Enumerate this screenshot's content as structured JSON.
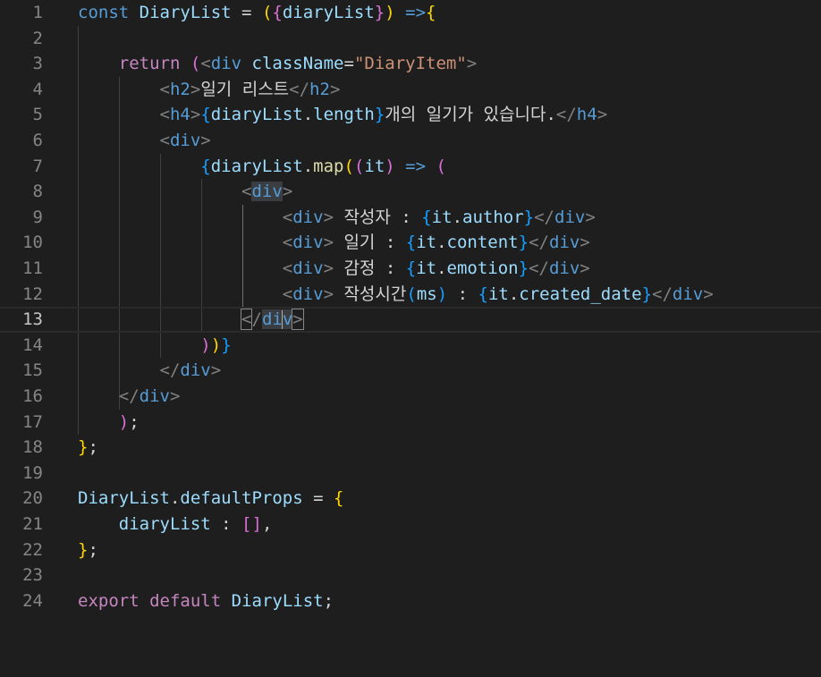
{
  "editor": {
    "theme": {
      "background": "#1e1e1e",
      "line_number": "#858585",
      "keyword": "#569cd6",
      "control": "#c586c0",
      "variable": "#9cdcfe",
      "function": "#dcdcaa",
      "string": "#ce9178",
      "bracket_gold": "#ffd700",
      "bracket_orchid": "#da70d6",
      "bracket_blue": "#179fff"
    },
    "current_line": 13,
    "lines": [
      {
        "n": "1",
        "tokens": [
          [
            "kw",
            "const"
          ],
          [
            "txt",
            " "
          ],
          [
            "var",
            "DiaryList"
          ],
          [
            "txt",
            " = "
          ],
          [
            "p1",
            "("
          ],
          [
            "p2",
            "{"
          ],
          [
            "var",
            "diaryList"
          ],
          [
            "p2",
            "}"
          ],
          [
            "p1",
            ")"
          ],
          [
            "txt",
            " "
          ],
          [
            "kw",
            "=>"
          ],
          [
            "p1",
            "{"
          ]
        ]
      },
      {
        "n": "2",
        "tokens": []
      },
      {
        "n": "3",
        "tokens": [
          [
            "txt",
            "    "
          ],
          [
            "ctl",
            "return"
          ],
          [
            "txt",
            " "
          ],
          [
            "p2",
            "("
          ],
          [
            "br",
            "<"
          ],
          [
            "tag",
            "div"
          ],
          [
            "txt",
            " "
          ],
          [
            "attr",
            "className"
          ],
          [
            "txt",
            "="
          ],
          [
            "str",
            "\"DiaryItem\""
          ],
          [
            "br",
            ">"
          ]
        ]
      },
      {
        "n": "4",
        "tokens": [
          [
            "txt",
            "        "
          ],
          [
            "br",
            "<"
          ],
          [
            "tag",
            "h2"
          ],
          [
            "br",
            ">"
          ],
          [
            "txt",
            "일기 리스트"
          ],
          [
            "br",
            "</"
          ],
          [
            "tag",
            "h2"
          ],
          [
            "br",
            ">"
          ]
        ]
      },
      {
        "n": "5",
        "tokens": [
          [
            "txt",
            "        "
          ],
          [
            "br",
            "<"
          ],
          [
            "tag",
            "h4"
          ],
          [
            "br",
            ">"
          ],
          [
            "p3",
            "{"
          ],
          [
            "var",
            "diaryList"
          ],
          [
            "txt",
            "."
          ],
          [
            "var",
            "length"
          ],
          [
            "p3",
            "}"
          ],
          [
            "txt",
            "개의 일기가 있습니다."
          ],
          [
            "br",
            "</"
          ],
          [
            "tag",
            "h4"
          ],
          [
            "br",
            ">"
          ]
        ]
      },
      {
        "n": "6",
        "tokens": [
          [
            "txt",
            "        "
          ],
          [
            "br",
            "<"
          ],
          [
            "tag",
            "div"
          ],
          [
            "br",
            ">"
          ]
        ]
      },
      {
        "n": "7",
        "tokens": [
          [
            "txt",
            "            "
          ],
          [
            "p3",
            "{"
          ],
          [
            "var",
            "diaryList"
          ],
          [
            "txt",
            "."
          ],
          [
            "fn",
            "map"
          ],
          [
            "p1",
            "("
          ],
          [
            "p2",
            "("
          ],
          [
            "var",
            "it"
          ],
          [
            "p2",
            ")"
          ],
          [
            "txt",
            " "
          ],
          [
            "kw",
            "=>"
          ],
          [
            "txt",
            " "
          ],
          [
            "p2",
            "("
          ]
        ]
      },
      {
        "n": "8",
        "tokens": [
          [
            "txt",
            "                "
          ],
          [
            "br",
            "<"
          ],
          [
            "tagsel",
            "div"
          ],
          [
            "br",
            ">"
          ]
        ]
      },
      {
        "n": "9",
        "tokens": [
          [
            "txt",
            "                    "
          ],
          [
            "br",
            "<"
          ],
          [
            "tag",
            "div"
          ],
          [
            "br",
            ">"
          ],
          [
            "txt",
            " 작성자 : "
          ],
          [
            "p3",
            "{"
          ],
          [
            "var",
            "it"
          ],
          [
            "txt",
            "."
          ],
          [
            "var",
            "author"
          ],
          [
            "p3",
            "}"
          ],
          [
            "br",
            "</"
          ],
          [
            "tag",
            "div"
          ],
          [
            "br",
            ">"
          ]
        ]
      },
      {
        "n": "10",
        "tokens": [
          [
            "txt",
            "                    "
          ],
          [
            "br",
            "<"
          ],
          [
            "tag",
            "div"
          ],
          [
            "br",
            ">"
          ],
          [
            "txt",
            " 일기 : "
          ],
          [
            "p3",
            "{"
          ],
          [
            "var",
            "it"
          ],
          [
            "txt",
            "."
          ],
          [
            "var",
            "content"
          ],
          [
            "p3",
            "}"
          ],
          [
            "br",
            "</"
          ],
          [
            "tag",
            "div"
          ],
          [
            "br",
            ">"
          ]
        ]
      },
      {
        "n": "11",
        "tokens": [
          [
            "txt",
            "                    "
          ],
          [
            "br",
            "<"
          ],
          [
            "tag",
            "div"
          ],
          [
            "br",
            ">"
          ],
          [
            "txt",
            " 감정 : "
          ],
          [
            "p3",
            "{"
          ],
          [
            "var",
            "it"
          ],
          [
            "txt",
            "."
          ],
          [
            "var",
            "emotion"
          ],
          [
            "p3",
            "}"
          ],
          [
            "br",
            "</"
          ],
          [
            "tag",
            "div"
          ],
          [
            "br",
            ">"
          ]
        ]
      },
      {
        "n": "12",
        "tokens": [
          [
            "txt",
            "                    "
          ],
          [
            "br",
            "<"
          ],
          [
            "tag",
            "div"
          ],
          [
            "br",
            ">"
          ],
          [
            "txt",
            " 작성시간"
          ],
          [
            "p3",
            "("
          ],
          [
            "var",
            "ms"
          ],
          [
            "p3",
            ")"
          ],
          [
            "txt",
            " : "
          ],
          [
            "p3",
            "{"
          ],
          [
            "var",
            "it"
          ],
          [
            "txt",
            "."
          ],
          [
            "var",
            "created_date"
          ],
          [
            "p3",
            "}"
          ],
          [
            "br",
            "</"
          ],
          [
            "tag",
            "div"
          ],
          [
            "br",
            ">"
          ]
        ]
      },
      {
        "n": "13",
        "tokens": [
          [
            "txt",
            "                "
          ],
          [
            "brm",
            "<"
          ],
          [
            "br",
            "/"
          ],
          [
            "tagsel",
            "di"
          ],
          [
            "caret",
            ""
          ],
          [
            "tagsel",
            "v"
          ],
          [
            "brm",
            ">"
          ]
        ]
      },
      {
        "n": "14",
        "tokens": [
          [
            "txt",
            "            "
          ],
          [
            "p2",
            ")"
          ],
          [
            "p1",
            ")"
          ],
          [
            "p3",
            "}"
          ]
        ]
      },
      {
        "n": "15",
        "tokens": [
          [
            "txt",
            "        "
          ],
          [
            "br",
            "</"
          ],
          [
            "tag",
            "div"
          ],
          [
            "br",
            ">"
          ]
        ]
      },
      {
        "n": "16",
        "tokens": [
          [
            "txt",
            "    "
          ],
          [
            "br",
            "</"
          ],
          [
            "tag",
            "div"
          ],
          [
            "br",
            ">"
          ]
        ]
      },
      {
        "n": "17",
        "tokens": [
          [
            "txt",
            "    "
          ],
          [
            "p2",
            ")"
          ],
          [
            "txt",
            ";"
          ]
        ]
      },
      {
        "n": "18",
        "tokens": [
          [
            "p1",
            "}"
          ],
          [
            "txt",
            ";"
          ]
        ]
      },
      {
        "n": "19",
        "tokens": []
      },
      {
        "n": "20",
        "tokens": [
          [
            "var",
            "DiaryList"
          ],
          [
            "txt",
            "."
          ],
          [
            "var",
            "defaultProps"
          ],
          [
            "txt",
            " = "
          ],
          [
            "p1",
            "{"
          ]
        ]
      },
      {
        "n": "21",
        "tokens": [
          [
            "txt",
            "    "
          ],
          [
            "var",
            "diaryList"
          ],
          [
            "txt",
            " : "
          ],
          [
            "p2",
            "["
          ],
          [
            "p2",
            "]"
          ],
          [
            "txt",
            ","
          ]
        ]
      },
      {
        "n": "22",
        "tokens": [
          [
            "p1",
            "}"
          ],
          [
            "txt",
            ";"
          ]
        ]
      },
      {
        "n": "23",
        "tokens": []
      },
      {
        "n": "24",
        "tokens": [
          [
            "ctl",
            "export"
          ],
          [
            "txt",
            " "
          ],
          [
            "ctl",
            "default"
          ],
          [
            "txt",
            " "
          ],
          [
            "var",
            "DiaryList"
          ],
          [
            "txt",
            ";"
          ]
        ]
      }
    ]
  }
}
